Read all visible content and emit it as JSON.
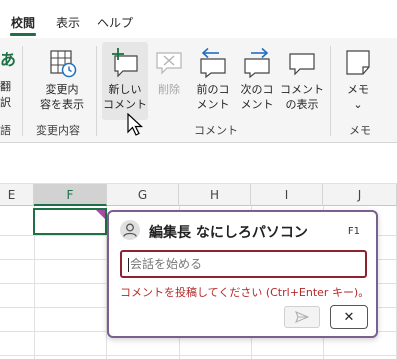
{
  "ribbon": {
    "tabs": [
      {
        "label": "校閲",
        "active": true
      },
      {
        "label": "表示",
        "active": false
      },
      {
        "label": "ヘルプ",
        "active": false
      }
    ],
    "partial_left": {
      "glyph": "あ",
      "text1": "翻",
      "text2": "訳",
      "group": "語"
    },
    "buttons": {
      "show_changes": {
        "line1": "変更内",
        "line2": "容を表示"
      },
      "new_comment": {
        "line1": "新しい",
        "line2": "コメント"
      },
      "delete": {
        "line1": "削除"
      },
      "previous_comment": {
        "line1": "前のコ",
        "line2": "メント"
      },
      "next_comment": {
        "line1": "次のコ",
        "line2": "メント"
      },
      "show_comments": {
        "line1": "コメント",
        "line2": "の表示"
      },
      "notes": {
        "line1": "メモ",
        "chevron": "⌄"
      }
    },
    "groups": {
      "changes": "変更内容",
      "comments": "コメント",
      "notes": "メモ"
    }
  },
  "sheet": {
    "columns": [
      "E",
      "F",
      "G",
      "H",
      "I",
      "J"
    ],
    "selected_column": "F"
  },
  "comment_card": {
    "author": "編集長 なにしろパソコン",
    "shortcut": "F1",
    "placeholder": "会話を始める",
    "error": "コメントを投稿してください (Ctrl+Enter キー)。",
    "close_symbol": "✕"
  },
  "colors": {
    "accent": "#1e7145",
    "card_border": "#7b5f8f",
    "error": "#b22a2a",
    "input_border": "#8e2231"
  }
}
